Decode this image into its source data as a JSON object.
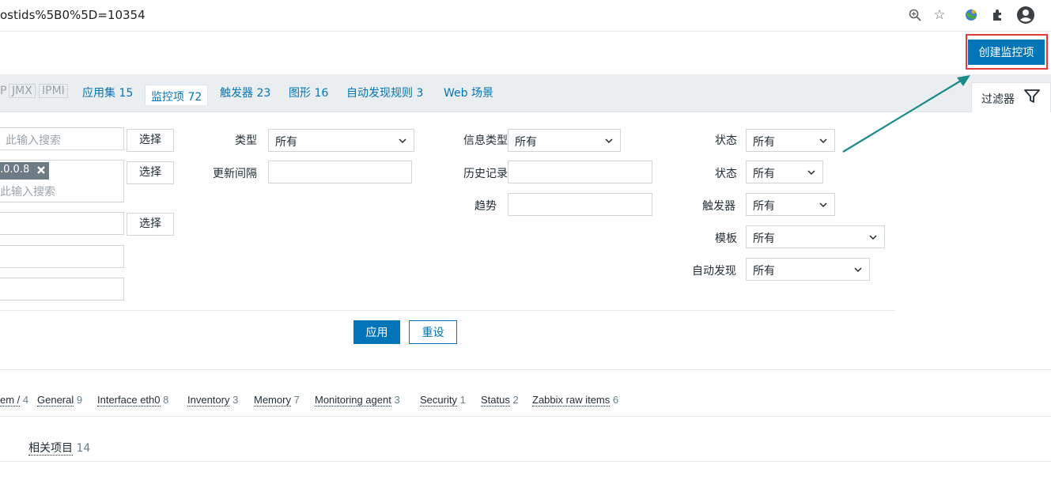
{
  "browser": {
    "url": "ostids%5B0%5D=10354",
    "icons": [
      "zoom-icon",
      "bookmark-star-icon",
      "extension-globe-icon",
      "extensions-puzzle-icon",
      "profile-avatar-icon"
    ]
  },
  "header": {
    "create_button": "创建监控项"
  },
  "tabs": {
    "partial": [
      "P",
      "JMX",
      "IPMI"
    ],
    "items": [
      {
        "label": "应用集",
        "count": "15"
      },
      {
        "label": "监控项",
        "count": "72"
      },
      {
        "label": "触发器",
        "count": "23"
      },
      {
        "label": "图形",
        "count": "16"
      },
      {
        "label": "自动发现规则",
        "count": "3"
      },
      {
        "label": "Web 场景",
        "count": ""
      }
    ],
    "filter_tab": "过滤器"
  },
  "filter": {
    "left": {
      "search_placeholder_1": "此输入搜索",
      "host_tag": ".0.0.8",
      "search_placeholder_2": "此输入搜索",
      "select_label": "选择"
    },
    "mid": {
      "type_label": "类型",
      "type_value": "所有",
      "interval_label": "更新间隔",
      "interval_value": ""
    },
    "mid2": {
      "info_type_label": "信息类型",
      "info_type_value": "所有",
      "history_label": "历史记录",
      "history_value": "",
      "trends_label": "趋势",
      "trends_value": ""
    },
    "right": {
      "state_label": "状态",
      "state_value": "所有",
      "status_label": "状态",
      "status_value": "所有",
      "triggers_label": "触发器",
      "triggers_value": "所有",
      "template_label": "模板",
      "template_value": "所有",
      "discovery_label": "自动发现",
      "discovery_value": "所有"
    },
    "apply": "应用",
    "reset": "重设"
  },
  "subfilter": [
    {
      "name": "em /",
      "count": "4"
    },
    {
      "name": "General",
      "count": "9"
    },
    {
      "name": "Interface eth0",
      "count": "8"
    },
    {
      "name": "Inventory",
      "count": "3"
    },
    {
      "name": "Memory",
      "count": "7"
    },
    {
      "name": "Monitoring agent",
      "count": "3"
    },
    {
      "name": "Security",
      "count": "1"
    },
    {
      "name": "Status",
      "count": "2"
    },
    {
      "name": "Zabbix raw items",
      "count": "6"
    }
  ],
  "related": {
    "name": "相关项目",
    "count": "14"
  },
  "colors": {
    "accent": "#0275b8",
    "highlight": "#e23b3b",
    "arrow": "#1a8a8a"
  }
}
